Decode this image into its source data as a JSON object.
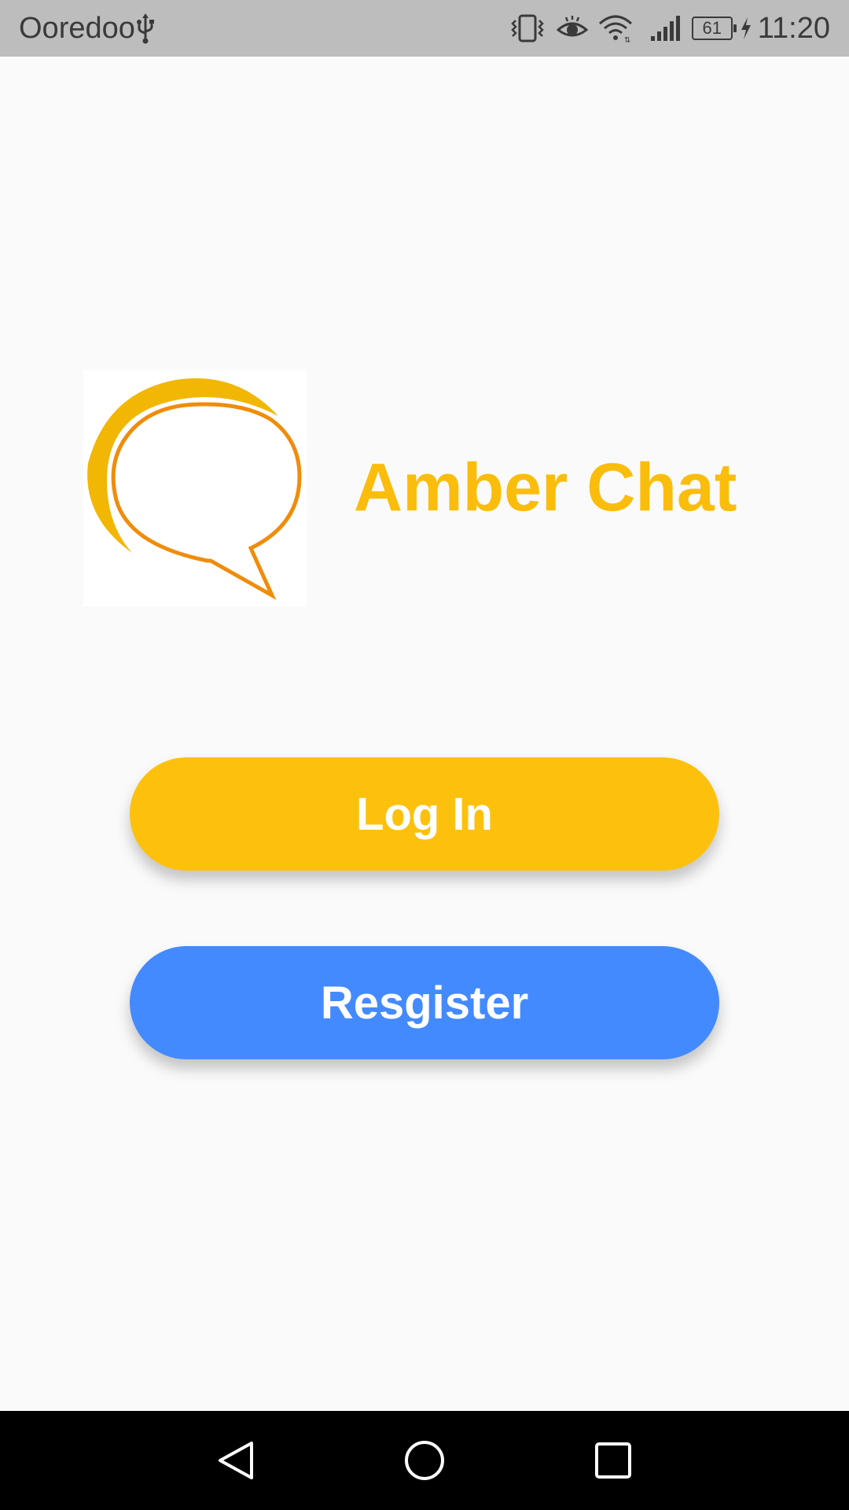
{
  "status_bar": {
    "carrier": "Ooredoo",
    "battery_level": "61",
    "time": "11:20",
    "icons": [
      "usb-icon",
      "vibrate-icon",
      "eye-icon",
      "wifi-icon",
      "signal-icon",
      "battery-icon",
      "charging-bolt-icon"
    ]
  },
  "app": {
    "title": "Amber Chat",
    "logo_icon": "chat-bubble-logo",
    "accent_color": "#fbbd0c"
  },
  "actions": {
    "login_label": "Log In",
    "login_color": "#fdc10d",
    "register_label": "Resgister",
    "register_color": "#448aff"
  },
  "navigation": {
    "buttons": [
      "back-icon",
      "home-icon",
      "recent-apps-icon"
    ]
  }
}
